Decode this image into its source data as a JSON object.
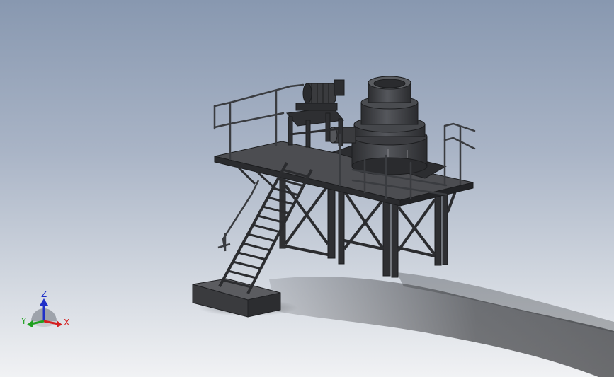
{
  "viewport": {
    "background_top": "#8898b0",
    "background_bottom": "#f1f2f4",
    "model_color": "#3c3d40",
    "shadow_color": "#2a2b2e"
  },
  "model": {
    "components": [
      "crusher-body",
      "drive-motor",
      "motor-base-frame",
      "feed-chute",
      "platform-deck",
      "guard-rails",
      "support-legs",
      "cross-bracing",
      "access-stair",
      "concrete-footing",
      "ground-shadow"
    ]
  },
  "triad": {
    "x_label": "X",
    "y_label": "Y",
    "z_label": "Z",
    "x_color": "#d42020",
    "y_color": "#20a020",
    "z_color": "#2030c8"
  }
}
